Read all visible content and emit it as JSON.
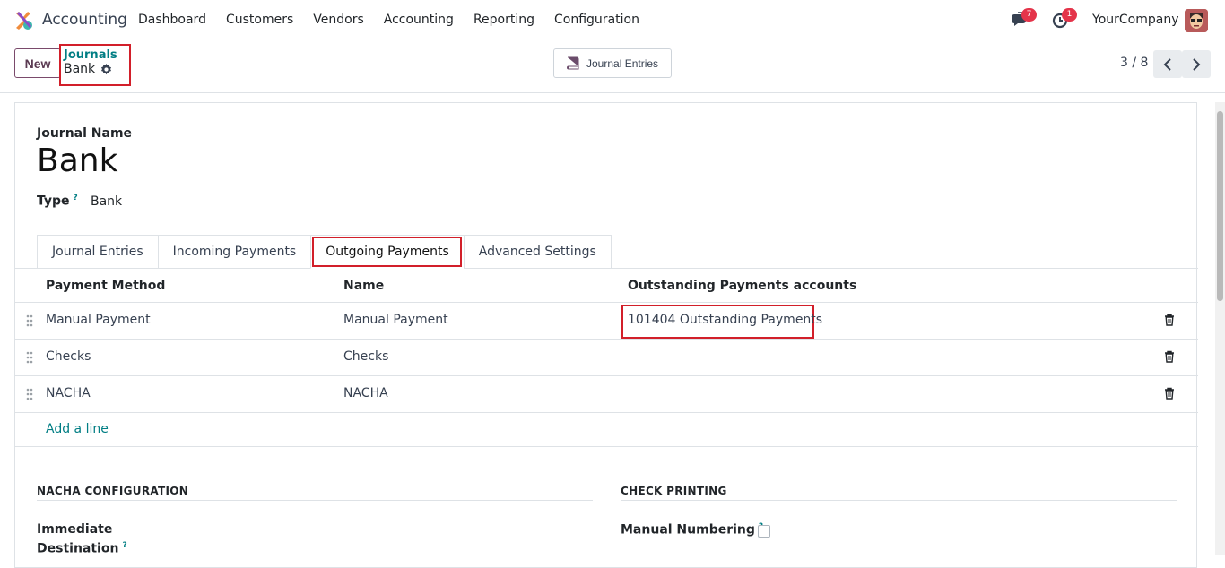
{
  "nav": {
    "app_name": "Accounting",
    "menu": [
      "Dashboard",
      "Customers",
      "Vendors",
      "Accounting",
      "Reporting",
      "Configuration"
    ],
    "messages_badge": "7",
    "activities_badge": "1",
    "company": "YourCompany"
  },
  "control_panel": {
    "new_label": "New",
    "breadcrumb_parent": "Journals",
    "breadcrumb_current": "Bank",
    "smart_button_label": "Journal Entries",
    "pager": "3 / 8"
  },
  "form": {
    "journal_name_label": "Journal Name",
    "journal_name": "Bank",
    "type_label": "Type",
    "type_help": "?",
    "type_value": "Bank",
    "tabs": [
      "Journal Entries",
      "Incoming Payments",
      "Outgoing Payments",
      "Advanced Settings"
    ],
    "active_tab": "Outgoing Payments"
  },
  "payments_table": {
    "columns": [
      "Payment Method",
      "Name",
      "Outstanding Payments accounts"
    ],
    "rows": [
      {
        "method": "Manual Payment",
        "name": "Manual Payment",
        "account": "101404 Outstanding Payments"
      },
      {
        "method": "Checks",
        "name": "Checks",
        "account": ""
      },
      {
        "method": "NACHA",
        "name": "NACHA",
        "account": ""
      }
    ],
    "add_line": "Add a line"
  },
  "sections": {
    "nacha_title": "NACHA CONFIGURATION",
    "nacha_field_1": "Immediate",
    "nacha_field_2": "Destination",
    "nacha_help": "?",
    "check_title": "CHECK PRINTING",
    "manual_numbering_label": "Manual Numbering",
    "manual_numbering_help": "?",
    "manual_numbering_checked": false
  },
  "colors": {
    "accent": "#017e84",
    "highlight": "#d21f2a",
    "badge": "#e4344a"
  }
}
